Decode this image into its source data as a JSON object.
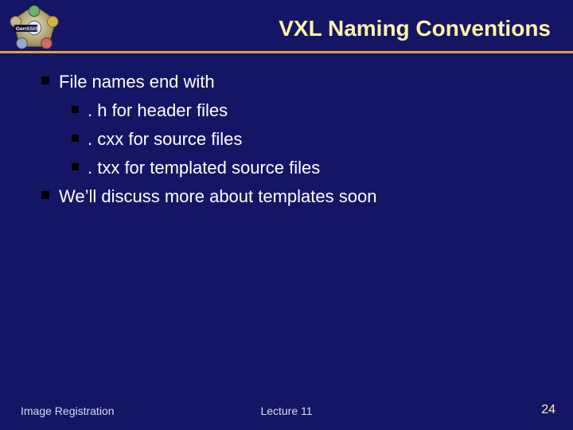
{
  "header": {
    "title": "VXL Naming Conventions",
    "logo_label": "GenSSIS"
  },
  "bullets": [
    {
      "text": "File names end with",
      "children": [
        ". h for header files",
        ". cxx for source files",
        ". txx for templated source files"
      ]
    },
    {
      "text": "We’ll discuss more about templates soon",
      "children": []
    }
  ],
  "footer": {
    "left": "Image Registration",
    "center": "Lecture 11",
    "page": "24"
  },
  "colors": {
    "background": "#151566",
    "title": "#fdf4a8",
    "rule": "#d9a53a",
    "body": "#ffffff"
  }
}
